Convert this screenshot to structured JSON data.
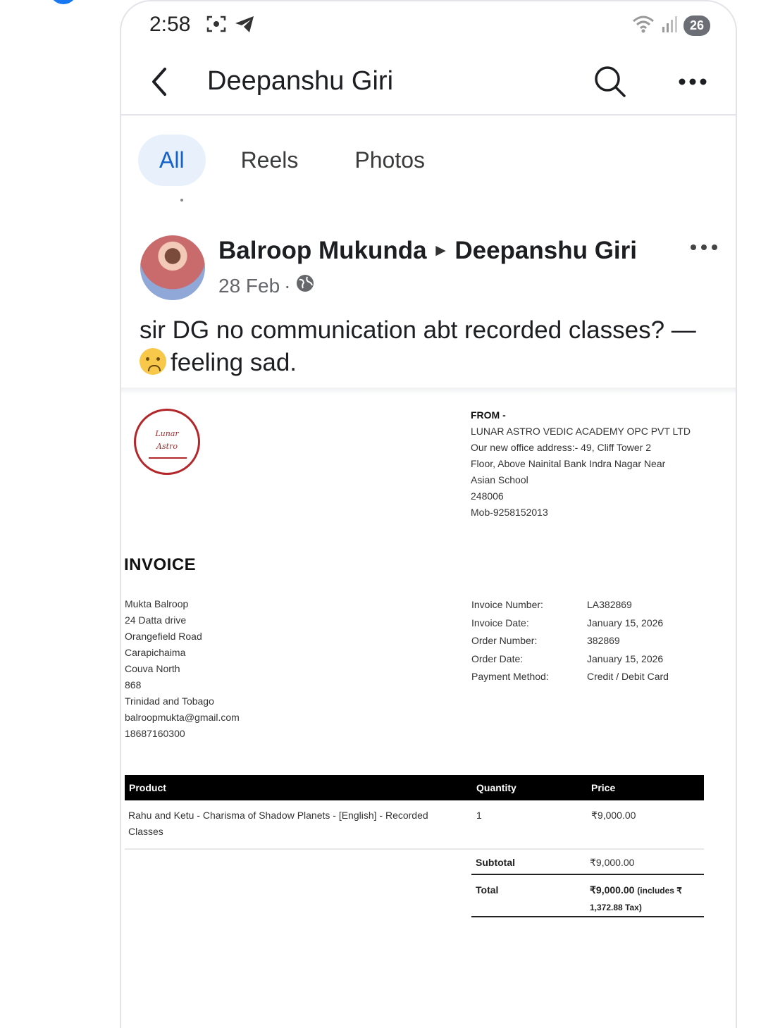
{
  "status_bar": {
    "time": "2:58",
    "battery": "26"
  },
  "header": {
    "title": "Deepanshu Giri"
  },
  "tabs": [
    {
      "label": "All"
    },
    {
      "label": "Reels"
    },
    {
      "label": "Photos"
    }
  ],
  "post": {
    "author": "Balroop Mukunda",
    "arrow": "►",
    "target": "Deepanshu Giri",
    "date": "28 Feb",
    "separator": "·",
    "text": "sir DG no communication abt recorded classes? —",
    "feeling": "feeling sad."
  },
  "invoice": {
    "logo_text_1": "Lunar",
    "logo_text_2": "Astro",
    "from_title": "FROM -",
    "from_lines": [
      "LUNAR ASTRO VEDIC ACADEMY OPC PVT LTD",
      "Our new office address:- 49, Cliff Tower 2",
      "Floor, Above Nainital Bank Indra Nagar Near",
      "Asian School",
      "248006",
      "Mob-9258152013"
    ],
    "title": "INVOICE",
    "bill_to": [
      "Mukta Balroop",
      "24 Datta drive",
      "Orangefield Road",
      "Carapichaima",
      "Couva North",
      "868",
      "Trinidad and Tobago",
      "balroopmukta@gmail.com",
      "18687160300"
    ],
    "meta": [
      {
        "label": "Invoice Number:",
        "value": "LA382869"
      },
      {
        "label": "Invoice Date:",
        "value": "January 15, 2026"
      },
      {
        "label": "Order Number:",
        "value": "382869"
      },
      {
        "label": "Order Date:",
        "value": "January 15, 2026"
      },
      {
        "label": "Payment Method:",
        "value": "Credit / Debit Card"
      }
    ],
    "table_headers": {
      "product": "Product",
      "quantity": "Quantity",
      "price": "Price"
    },
    "item": {
      "product_line_1": "Rahu and Ketu - Charisma of Shadow Planets - [English] - Recorded",
      "product_line_2": "Classes",
      "quantity": "1",
      "price": "₹9,000.00"
    },
    "subtotal_label": "Subtotal",
    "subtotal_value": "₹9,000.00",
    "total_label": "Total",
    "total_value": "₹9,000.00",
    "total_note_1": "(includes ₹",
    "total_note_2": "1,372.88 Tax)"
  },
  "colors": {
    "accent": "#1877f2",
    "active_tab_bg": "#e7f0fb",
    "active_tab_text": "#1461c9",
    "logo_red": "#b3262a"
  }
}
